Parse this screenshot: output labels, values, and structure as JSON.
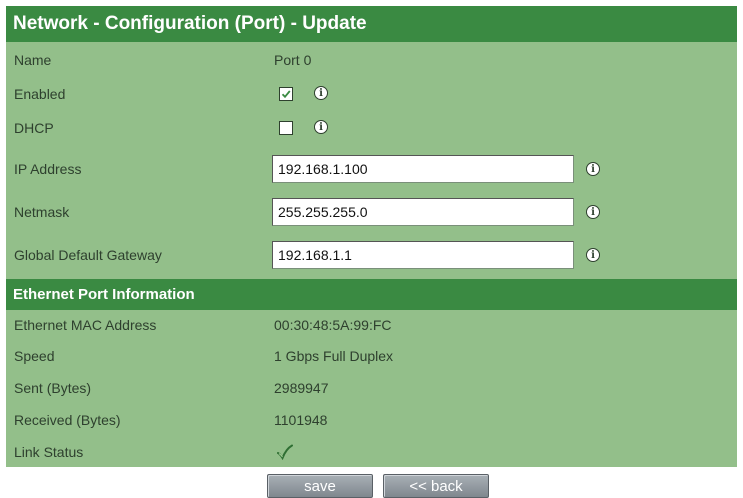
{
  "header": {
    "title": "Network - Configuration (Port) - Update"
  },
  "config": {
    "name_label": "Name",
    "name_value": "Port 0",
    "enabled_label": "Enabled",
    "enabled_checked": true,
    "dhcp_label": "DHCP",
    "dhcp_checked": false,
    "ip_label": "IP Address",
    "ip_value": "192.168.1.100",
    "netmask_label": "Netmask",
    "netmask_value": "255.255.255.0",
    "gateway_label": "Global Default Gateway",
    "gateway_value": "192.168.1.1"
  },
  "ethernet": {
    "section_title": "Ethernet Port Information",
    "mac_label": "Ethernet MAC Address",
    "mac_value": "00:30:48:5A:99:FC",
    "speed_label": "Speed",
    "speed_value": "1 Gbps Full Duplex",
    "sent_label": "Sent (Bytes)",
    "sent_value": "2989947",
    "received_label": "Received (Bytes)",
    "received_value": "1101948",
    "link_label": "Link Status",
    "link_icon": "checkmark-icon"
  },
  "buttons": {
    "save": "save",
    "back": "<< back"
  },
  "icons": {
    "info": "info-icon"
  },
  "colors": {
    "panel": "#93bf8a",
    "header": "#3a8a42",
    "text": "#2e402e"
  }
}
